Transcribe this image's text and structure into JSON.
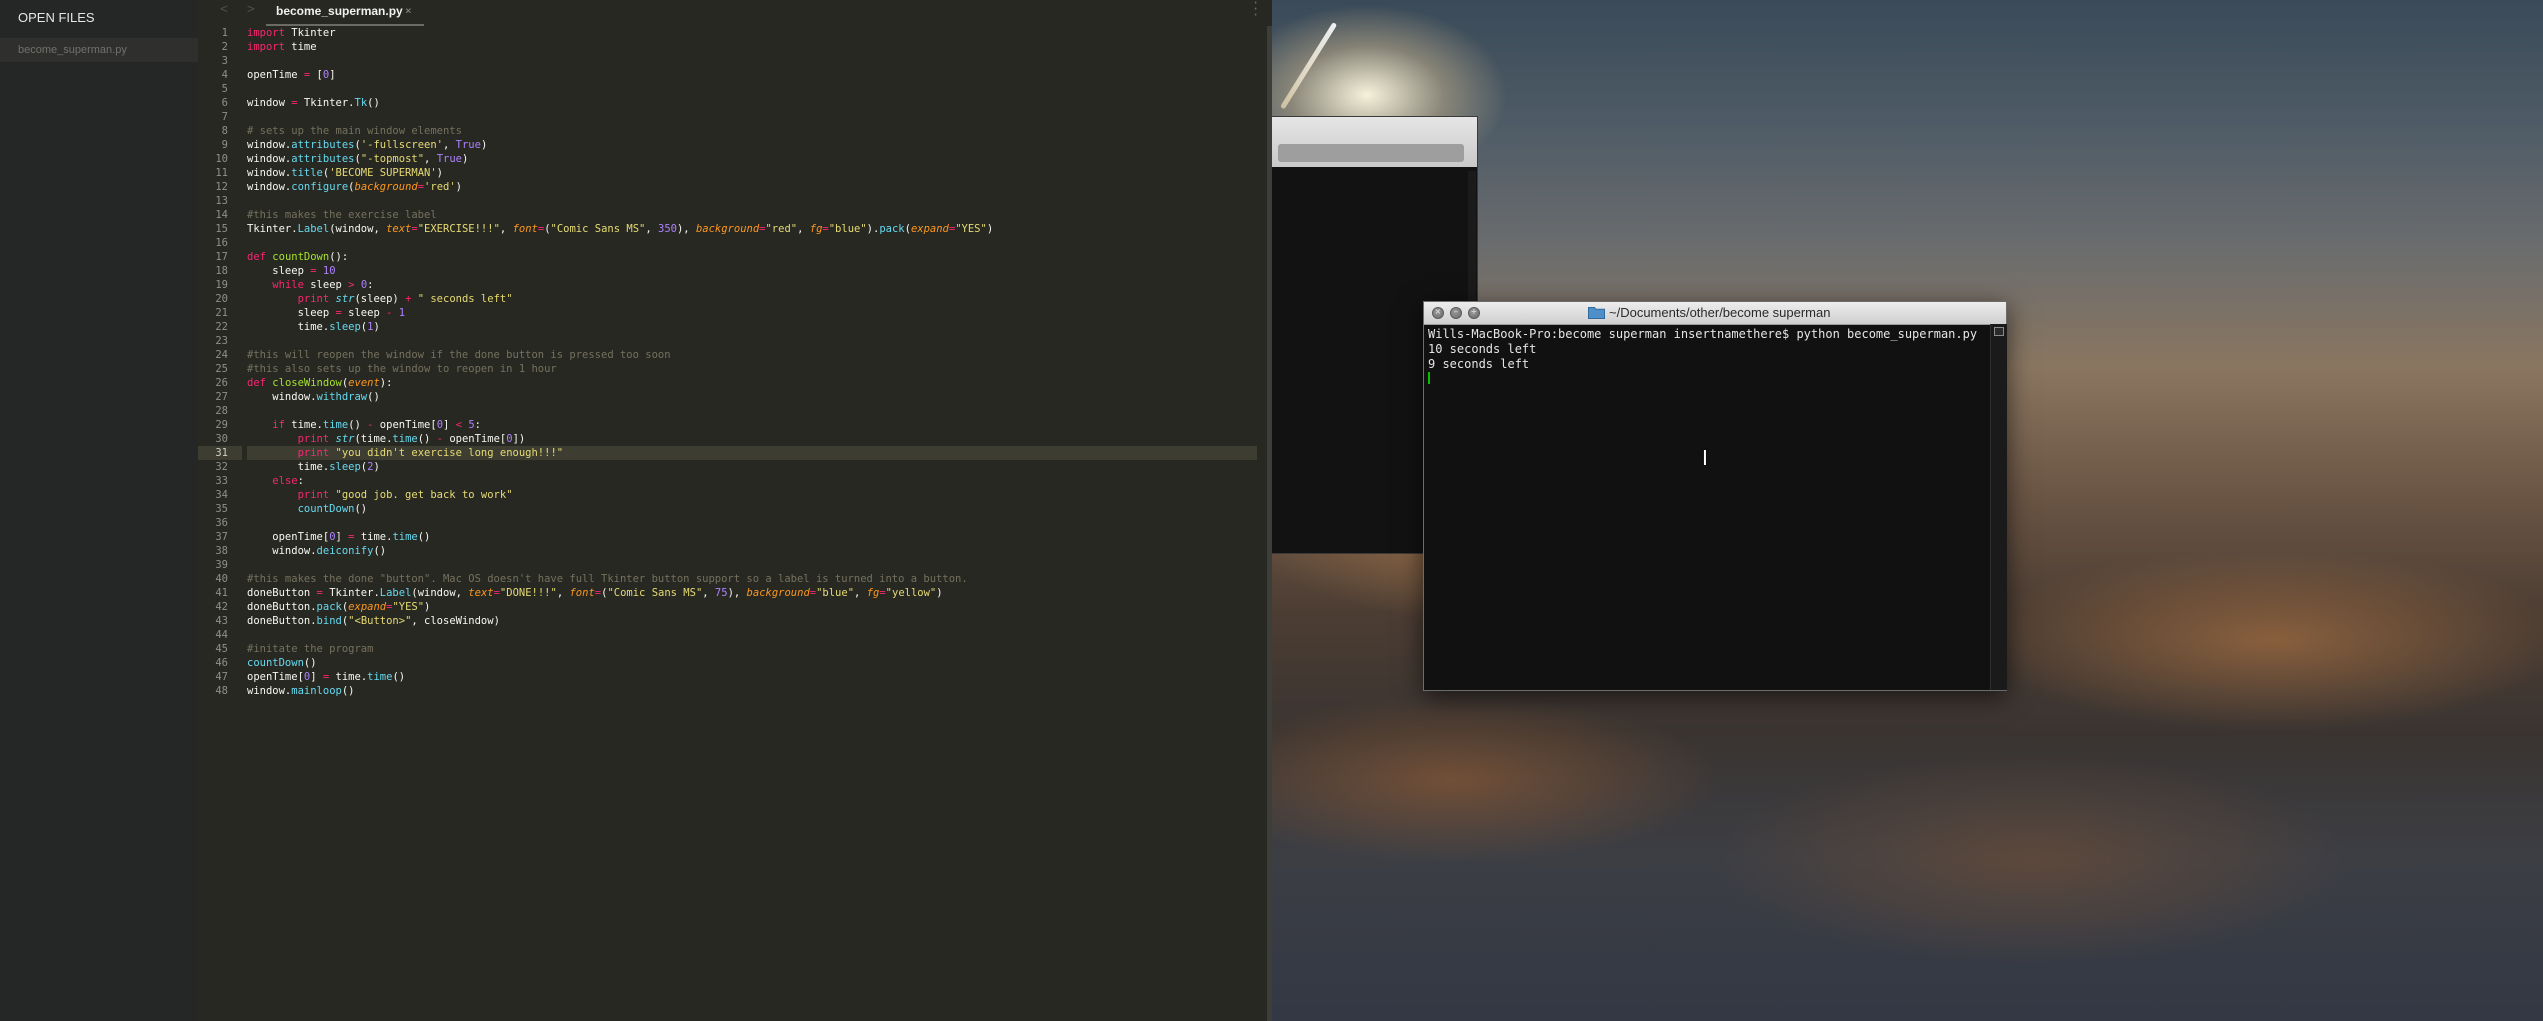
{
  "sidebar": {
    "heading": "OPEN FILES",
    "files": [
      "become_superman.py"
    ]
  },
  "editor": {
    "tab": {
      "label": "become_superman.py",
      "close": "×"
    },
    "nav": {
      "back": "<",
      "forward": ">"
    },
    "highlighted_line": 31,
    "line_numbers": [
      "1",
      "2",
      "3",
      "4",
      "5",
      "6",
      "7",
      "8",
      "9",
      "10",
      "11",
      "12",
      "13",
      "14",
      "15",
      "16",
      "17",
      "18",
      "19",
      "20",
      "21",
      "22",
      "23",
      "24",
      "25",
      "26",
      "27",
      "28",
      "29",
      "30",
      "31",
      "32",
      "33",
      "34",
      "35",
      "36",
      "37",
      "38",
      "39",
      "40",
      "41",
      "42",
      "43",
      "44",
      "45",
      "46",
      "47",
      "48"
    ],
    "code_lines": [
      "import Tkinter",
      "import time",
      "",
      "openTime = [0]",
      "",
      "window = Tkinter.Tk()",
      "",
      "# sets up the main window elements",
      "window.attributes('-fullscreen', True)",
      "window.attributes(\"-topmost\", True)",
      "window.title('BECOME SUPERMAN')",
      "window.configure(background='red')",
      "",
      "#this makes the exercise label",
      "Tkinter.Label(window, text=\"EXERCISE!!!\", font=(\"Comic Sans MS\", 350), background=\"red\", fg=\"blue\").pack(expand=\"YES\")",
      "",
      "def countDown():",
      "    sleep = 10",
      "    while sleep > 0:",
      "        print str(sleep) + \" seconds left\"",
      "        sleep = sleep - 1",
      "        time.sleep(1)",
      "",
      "#this will reopen the window if the done button is pressed too soon",
      "#this also sets up the window to reopen in 1 hour",
      "def closeWindow(event):",
      "    window.withdraw()",
      "",
      "    if time.time() - openTime[0] < 5:",
      "        print str(time.time() - openTime[0])",
      "        print \"you didn't exercise long enough!!!\"",
      "        time.sleep(2)",
      "    else:",
      "        print \"good job. get back to work\"",
      "        countDown()",
      "",
      "    openTime[0] = time.time()",
      "    window.deiconify()",
      "",
      "#this makes the done \"button\". Mac OS doesn't have full Tkinter button support so a label is turned into a button.",
      "doneButton = Tkinter.Label(window, text=\"DONE!!!\", font=(\"Comic Sans MS\", 75), background=\"blue\", fg=\"yellow\")",
      "doneButton.pack(expand=\"YES\")",
      "doneButton.bind(\"<Button>\", closeWindow)",
      "",
      "#initate the program",
      "countDown()",
      "openTime[0] = time.time()",
      "window.mainloop()"
    ]
  },
  "terminal": {
    "title": "~/Documents/other/become superman",
    "lines": [
      "Wills-MacBook-Pro:become superman insertnamethere$ python become_superman.py",
      "10 seconds left",
      "9 seconds left"
    ],
    "buttons": {
      "close": "×",
      "minimize": "–",
      "zoom": "+"
    }
  },
  "icons": {
    "folder": "folder-icon",
    "ibeam": "text-cursor-icon"
  },
  "colors": {
    "editor_bg": "#272822",
    "sidebar_bg": "#252626",
    "terminal_bg": "#111111",
    "keyword": "#f92672",
    "string": "#e6db74",
    "number": "#ae81ff",
    "comment": "#75715e",
    "function": "#66d9ef",
    "cursor_green": "#00c000"
  }
}
